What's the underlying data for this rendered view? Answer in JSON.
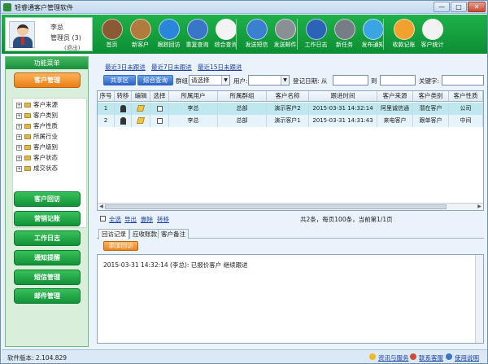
{
  "window": {
    "title": "轻睿通客户管理软件",
    "min": "—",
    "max": "□",
    "close": "✕"
  },
  "user": {
    "name": "李总",
    "role": "管理员 (3)",
    "logout": "(退出)"
  },
  "toolbar": [
    {
      "label": "首页",
      "icon": "home-icon",
      "color": "#8a5a34"
    },
    {
      "label": "新客户",
      "icon": "new-customer-icon",
      "color": "#b07b3c"
    },
    {
      "label": "跟踪回访",
      "icon": "chat-icon",
      "color": "#2a86d8"
    },
    {
      "label": "重复查询",
      "icon": "p-icon",
      "color": "#3a76c8"
    },
    {
      "label": "综合查询",
      "icon": "search-list-icon",
      "color": "#f3f3f3"
    },
    {
      "label": "发送短信",
      "icon": "sms-icon",
      "color": "#3a7fd0"
    },
    {
      "label": "发送邮件",
      "icon": "mail-icon",
      "color": "#8a8f96"
    },
    {
      "label": "工作日志",
      "icon": "worklog-icon",
      "color": "#2b63b8"
    },
    {
      "label": "新任务",
      "icon": "task-icon",
      "color": "#777d86"
    },
    {
      "label": "发布通知",
      "icon": "twitter-icon",
      "color": "#3ba5e3"
    },
    {
      "label": "收款记账",
      "icon": "money-icon",
      "color": "#f2a12e"
    },
    {
      "label": "客户统计",
      "icon": "chart-icon",
      "color": "#f2f2f2"
    }
  ],
  "sidebar": {
    "heading": "功能菜单",
    "active": "客户管理",
    "tree": [
      "客户来源",
      "客户类别",
      "客户性质",
      "所属行业",
      "客户级别",
      "客户状态",
      "成交状态"
    ],
    "buttons": [
      "客户回访",
      "营销记账",
      "工作日志",
      "通知提醒",
      "短信管理",
      "邮件管理"
    ]
  },
  "recent": [
    "最近3日未跟进",
    "最近7日未跟进",
    "最近15日未跟进"
  ],
  "filter": {
    "btn_shared": "共享区",
    "btn_combined": "综合查询",
    "group_label": "群组:",
    "group_value": "请选择",
    "user_label": "用户:",
    "user_value": "",
    "date_label": "登记日期: 从",
    "to_label": "到",
    "keyword_label": "关键字:"
  },
  "grid": {
    "headers": [
      "序号",
      "转移",
      "编辑",
      "选择",
      "所属用户",
      "所属群组",
      "客户名称",
      "跟进时间",
      "客户来源",
      "客户类别",
      "客户性质"
    ],
    "rows": [
      [
        "1",
        "",
        "",
        "",
        "李总",
        "总部",
        "演示客户2",
        "2015-03-31 14:32:14",
        "阿里诚信通",
        "潜在客户",
        "公司"
      ],
      [
        "2",
        "",
        "",
        "",
        "李总",
        "总部",
        "演示客户1",
        "2015-03-31 14:31:43",
        "来电客户",
        "跟单客户",
        "中间"
      ]
    ]
  },
  "actions": [
    "全选",
    "导出",
    "删除",
    "转移"
  ],
  "pagination": "共2条，每页100条，当前第1/1页",
  "tabs": [
    "回访记录",
    "应收账款",
    "客户备注"
  ],
  "add_visit": "添加回访",
  "log_text": "2015-03-31 14:32:14 (李总): 已报价客户 继续跟进",
  "status": {
    "version": "软件版本: 2.104.829",
    "links": [
      "资讯与服务",
      "联系客服",
      "使用说明"
    ]
  }
}
